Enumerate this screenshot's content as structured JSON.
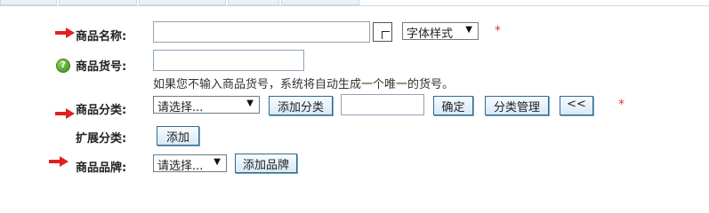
{
  "labels": {
    "goods_name": "商品名称:",
    "goods_sn": "商品货号:",
    "category": "商品分类:",
    "extended_category": "扩展分类:",
    "brand": "商品品牌:"
  },
  "required_mark": "*",
  "font_style": {
    "selected": "字体样式"
  },
  "goods_sn_hint": "如果您不输入商品货号，系统将自动生成一个唯一的货号。",
  "category": {
    "select_value": "请选择...",
    "add_button": "添加分类",
    "confirm_button": "确定",
    "manage_button": "分类管理",
    "collapse_button": "<<"
  },
  "extended_category": {
    "add_button": "添加"
  },
  "brand": {
    "select_value": "请选择...",
    "add_button": "添加品牌"
  },
  "colors": {
    "required": "#d23b3b",
    "arrow": "#e02020",
    "help_icon": "#4ea52f",
    "button_border": "#2f6c8f"
  },
  "icons": {
    "arrow": "red-arrow-icon",
    "help": "question-mark-icon"
  }
}
